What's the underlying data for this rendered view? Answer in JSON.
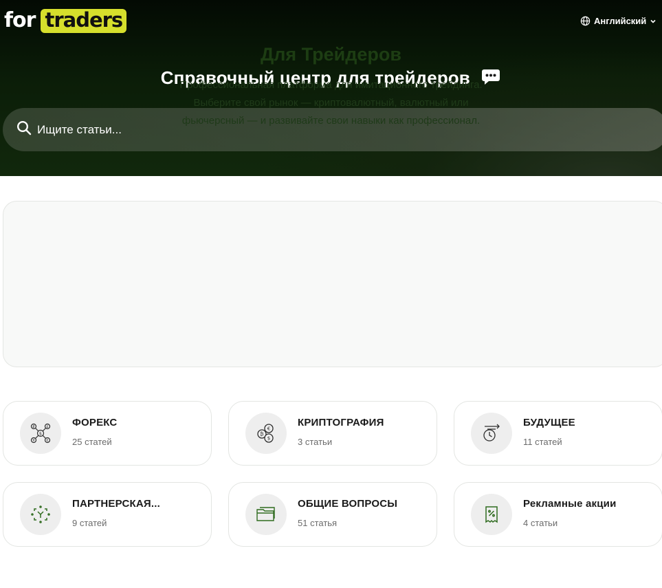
{
  "header": {
    "logo_for": "for",
    "logo_traders": "traders",
    "language_label": "Английский",
    "title": "Справочный центр для трейдеров",
    "search_placeholder": "Ищите статьи..."
  },
  "intro": {
    "title": "Для Трейдеров",
    "lines": [
      "Профессиональная платформа для имитационного трейдинга.",
      "Выберите свой рынок — криптовалютный, валютный или",
      "фьючерсный — и развивайте свои навыки как профессионал."
    ]
  },
  "categories": [
    {
      "title": "ФОРЕКС",
      "count": "25 статей",
      "icon": "forex-currency-icon"
    },
    {
      "title": "КРИПТОГРАФИЯ",
      "count": "3 статьи",
      "icon": "crypto-coins-icon"
    },
    {
      "title": "БУДУЩЕЕ",
      "count": "11 статей",
      "icon": "futures-clock-icon"
    },
    {
      "title": "ПАРТНЕРСКАЯ...",
      "count": "9 статей",
      "icon": "affiliate-icon"
    },
    {
      "title": "ОБЩИЕ ВОПРОСЫ",
      "count": "51 статья",
      "icon": "folder-icon"
    },
    {
      "title": "Рекламные акции",
      "count": "4 статьи",
      "icon": "promo-receipt-icon"
    }
  ],
  "colors": {
    "brand_yellow": "#d6df2c",
    "hero_dark_green": "#0b1d08",
    "intro_title_green": "#1d3d13",
    "icon_green": "#2f6b1f"
  }
}
